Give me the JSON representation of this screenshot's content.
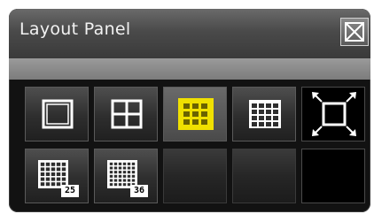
{
  "panel": {
    "title": "Layout Panel"
  },
  "colors": {
    "accent": "#f0e000",
    "icon": "#ffffff"
  },
  "icons": {
    "close": "close-icon",
    "layout_1": "layout-1x1-icon",
    "layout_4": "layout-2x2-icon",
    "layout_9": "layout-3x3-icon",
    "layout_16": "layout-4x4-icon",
    "fullscreen": "fullscreen-icon",
    "layout_25": "layout-5x5-icon",
    "layout_36": "layout-6x6-icon"
  },
  "layouts": {
    "selected": "layout_9",
    "badge_25": "25",
    "badge_36": "36"
  }
}
